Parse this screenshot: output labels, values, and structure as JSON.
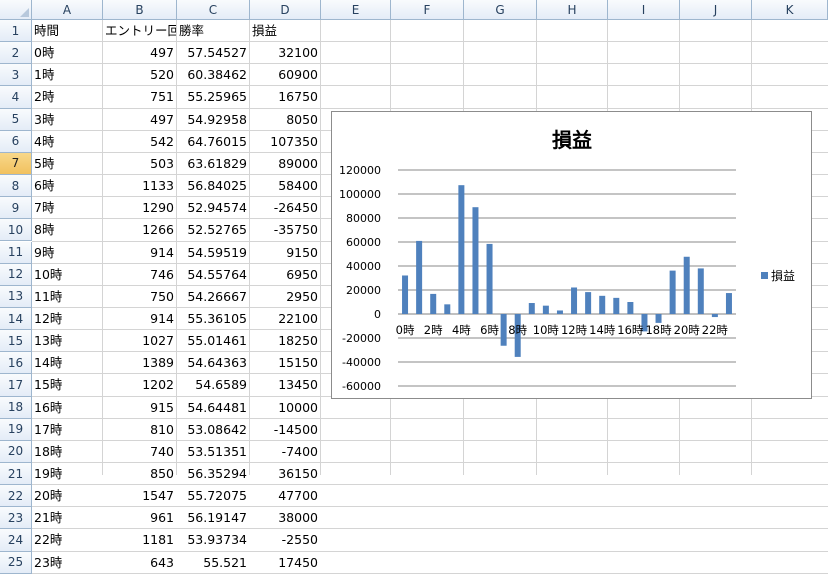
{
  "columns": [
    "A",
    "B",
    "C",
    "D",
    "E",
    "F",
    "G",
    "H",
    "I",
    "J",
    "K"
  ],
  "selected_row": "7",
  "header_row": [
    "時間",
    "エントリー回数",
    "勝率",
    "損益"
  ],
  "rows": [
    [
      "0時",
      "497",
      "57.54527",
      "32100"
    ],
    [
      "1時",
      "520",
      "60.38462",
      "60900"
    ],
    [
      "2時",
      "751",
      "55.25965",
      "16750"
    ],
    [
      "3時",
      "497",
      "54.92958",
      "8050"
    ],
    [
      "4時",
      "542",
      "64.76015",
      "107350"
    ],
    [
      "5時",
      "503",
      "63.61829",
      "89000"
    ],
    [
      "6時",
      "1133",
      "56.84025",
      "58400"
    ],
    [
      "7時",
      "1290",
      "52.94574",
      "-26450"
    ],
    [
      "8時",
      "1266",
      "52.52765",
      "-35750"
    ],
    [
      "9時",
      "914",
      "54.59519",
      "9150"
    ],
    [
      "10時",
      "746",
      "54.55764",
      "6950"
    ],
    [
      "11時",
      "750",
      "54.26667",
      "2950"
    ],
    [
      "12時",
      "914",
      "55.36105",
      "22100"
    ],
    [
      "13時",
      "1027",
      "55.01461",
      "18250"
    ],
    [
      "14時",
      "1389",
      "54.64363",
      "15150"
    ],
    [
      "15時",
      "1202",
      "54.6589",
      "13450"
    ],
    [
      "16時",
      "915",
      "54.64481",
      "10000"
    ],
    [
      "17時",
      "810",
      "53.08642",
      "-14500"
    ],
    [
      "18時",
      "740",
      "53.51351",
      "-7400"
    ],
    [
      "19時",
      "850",
      "56.35294",
      "36150"
    ],
    [
      "20時",
      "1547",
      "55.72075",
      "47700"
    ],
    [
      "21時",
      "961",
      "56.19147",
      "38000"
    ],
    [
      "22時",
      "1181",
      "53.93734",
      "-2550"
    ],
    [
      "23時",
      "643",
      "55.521",
      "17450"
    ]
  ],
  "colors": {
    "bar": "#4f81bd",
    "header_bg": "#e4ecf7",
    "header_selected": "#f1c15f",
    "grid": "#d4d4d4"
  },
  "chart_data": {
    "type": "bar",
    "title": "損益",
    "categories": [
      "0時",
      "1時",
      "2時",
      "3時",
      "4時",
      "5時",
      "6時",
      "7時",
      "8時",
      "9時",
      "10時",
      "11時",
      "12時",
      "13時",
      "14時",
      "15時",
      "16時",
      "17時",
      "18時",
      "19時",
      "20時",
      "21時",
      "22時",
      "23時"
    ],
    "visible_x_labels": [
      "0時",
      "2時",
      "4時",
      "6時",
      "8時",
      "10時",
      "12時",
      "14時",
      "16時",
      "18時",
      "20時",
      "22時"
    ],
    "series": [
      {
        "name": "損益",
        "values": [
          32100,
          60900,
          16750,
          8050,
          107350,
          89000,
          58400,
          -26450,
          -35750,
          9150,
          6950,
          2950,
          22100,
          18250,
          15150,
          13450,
          10000,
          -14500,
          -7400,
          36150,
          47700,
          38000,
          -2550,
          17450
        ]
      }
    ],
    "yticks": [
      120000,
      100000,
      80000,
      60000,
      40000,
      20000,
      0,
      -20000,
      -40000,
      -60000
    ],
    "ylim": [
      -60000,
      120000
    ],
    "grid": true,
    "legend_position": "right"
  }
}
